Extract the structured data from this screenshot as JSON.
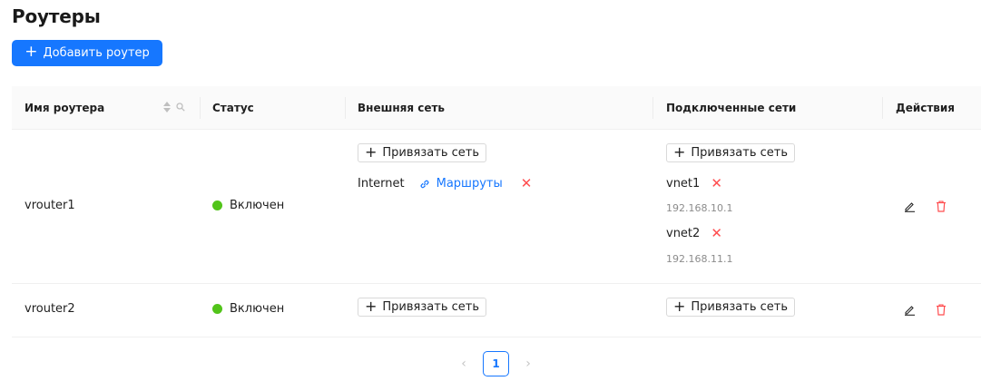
{
  "page": {
    "title": "Роутеры"
  },
  "toolbar": {
    "add_label": "Добавить роутер"
  },
  "table": {
    "columns": {
      "name": "Имя роутера",
      "status": "Статус",
      "external": "Внешняя сеть",
      "connected": "Подключенные сети",
      "actions": "Действия"
    },
    "bind_label": "Привязать сеть",
    "rows": [
      {
        "name": "vrouter1",
        "status": "Включен",
        "external_network": "Internet",
        "routes_label": "Маршруты",
        "connected": [
          {
            "name": "vnet1",
            "ip": "192.168.10.1"
          },
          {
            "name": "vnet2",
            "ip": "192.168.11.1"
          }
        ]
      },
      {
        "name": "vrouter2",
        "status": "Включен"
      }
    ]
  },
  "pagination": {
    "current": "1"
  },
  "colors": {
    "accent": "#1677ff",
    "status_on": "#52c41a",
    "danger": "#ff4d4f"
  }
}
